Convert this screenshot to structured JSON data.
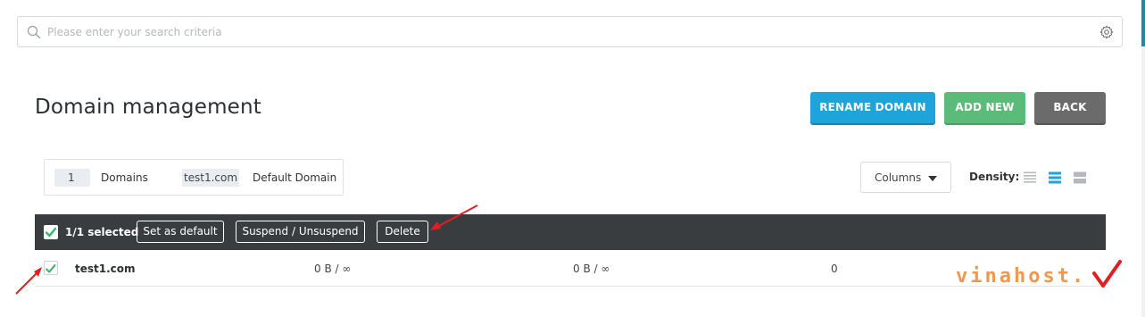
{
  "search": {
    "placeholder": "Please enter your search criteria"
  },
  "page": {
    "title": "Domain management"
  },
  "header_buttons": {
    "rename": "RENAME DOMAIN",
    "add": "ADD NEW",
    "back": "BACK"
  },
  "summary": {
    "count": "1",
    "count_label": "Domains",
    "default_domain": "test1.com",
    "default_label": "Default Domain"
  },
  "toolbar": {
    "columns_label": "Columns",
    "density_label": "Density:",
    "density_selected": "medium"
  },
  "bulk_actions": {
    "selected_text": "1/1 selected",
    "set_default": "Set as default",
    "suspend": "Suspend / Unsuspend",
    "delete": "Delete"
  },
  "table": {
    "rows": [
      {
        "name": "test1.com",
        "col1": "0 B / ∞",
        "col2": "0 B / ∞",
        "col3": "0",
        "checked": true
      }
    ]
  },
  "watermark": {
    "text": "vinahost."
  },
  "colors": {
    "accent_blue": "#1fa3db",
    "accent_green": "#5bbc7a",
    "back_gray": "#6b6b6b",
    "bar_dark": "#3a3d40",
    "check_green": "#3cb371",
    "arrow_red": "#e02020",
    "watermark_orange": "#f08c3c"
  },
  "icons": {
    "search": "search-icon",
    "settings": "gear-icon",
    "caret": "caret-down-icon",
    "check": "checkmark-icon"
  }
}
